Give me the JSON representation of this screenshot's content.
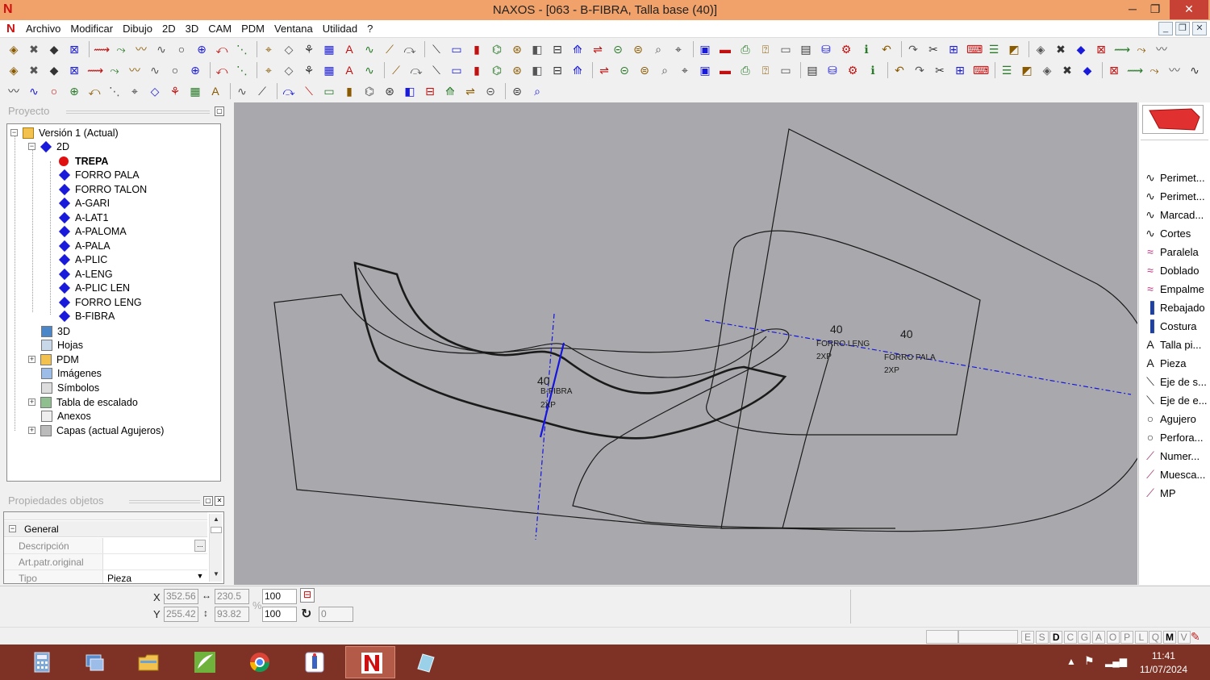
{
  "window": {
    "title": "NAXOS - [063 - B-FIBRA, Talla base (40)]",
    "logo": "N",
    "controls": {
      "minimize": "─",
      "maximize": "❐",
      "close": "✕"
    }
  },
  "menu": {
    "items": [
      "Archivo",
      "Modificar",
      "Dibujo",
      "2D",
      "3D",
      "CAM",
      "PDM",
      "Ventana",
      "Utilidad",
      "?"
    ],
    "mdi_controls": [
      "_",
      "❐",
      "✕"
    ]
  },
  "project_panel": {
    "title": "Proyecto",
    "tree": {
      "version": "Versión 1 (Actual)",
      "node_2d": "2D",
      "pieces": [
        "TREPA",
        "FORRO PALA",
        "FORRO TALON",
        "A-GARI",
        "A-LAT1",
        "A-PALOMA",
        "A-PALA",
        "A-PLIC",
        "A-LENG",
        "A-PLIC LEN",
        "FORRO LENG",
        "B-FIBRA"
      ],
      "active_piece": "TREPA",
      "others": [
        "3D",
        "Hojas",
        "PDM",
        "Imágenes",
        "Símbolos",
        "Tabla de escalado",
        "Anexos",
        "Capas (actual Agujeros)"
      ]
    }
  },
  "properties_panel": {
    "title": "Propiedades objetos",
    "group": "General",
    "rows": [
      {
        "name": "Descripción",
        "value": ""
      },
      {
        "name": "Art.patr.original",
        "value": ""
      },
      {
        "name": "Tipo",
        "value": "Pieza"
      }
    ],
    "ellipsis": "...",
    "dropdown_arrow": "▼"
  },
  "canvas": {
    "labels": {
      "bfibra": {
        "size": "40",
        "name": "B-FIBRA",
        "qty": "2XP"
      },
      "forro_leng": {
        "size": "40",
        "name": "FORRO LENG",
        "qty": "2XP"
      },
      "forro_pala": {
        "size": "40",
        "name": "FORRO PALA",
        "qty": "2XP"
      }
    },
    "colors": {
      "background": "#a9a9ad",
      "outline": "#1a1a1a",
      "axis": "#1515e0"
    }
  },
  "right_palette": {
    "items": [
      "Perimet...",
      "Perimet...",
      "Marcad...",
      "Cortes",
      "Paralela",
      "Doblado",
      "Empalme",
      "Rebajado",
      "Costura",
      "Talla pi...",
      "Pieza",
      "Eje de s...",
      "Eje de e...",
      "Agujero",
      "Perfora...",
      "Numer...",
      "Muesca...",
      "MP"
    ]
  },
  "coords": {
    "x_label": "X",
    "y_label": "Y",
    "x": "352.56",
    "y": "255.42",
    "w": "230.5",
    "h": "93.82",
    "scale_x": "100",
    "scale_y": "100",
    "rotation": "0",
    "percent": "%"
  },
  "status_letters": [
    "E",
    "S",
    "D",
    "C",
    "G",
    "A",
    "O",
    "P",
    "L",
    "Q",
    "M",
    "V"
  ],
  "taskbar": {
    "time": "11:41",
    "date": "11/07/2024"
  }
}
